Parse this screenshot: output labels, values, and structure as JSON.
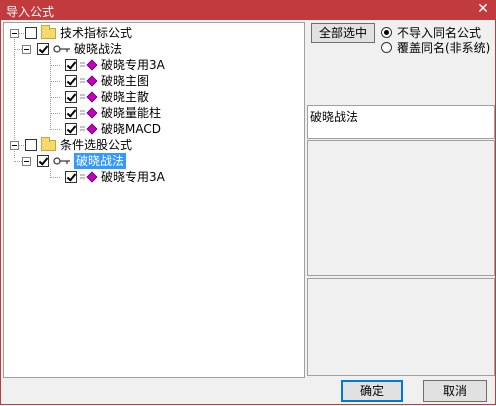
{
  "window": {
    "title": "导入公式",
    "close_glyph": "✕"
  },
  "tree": {
    "groups": [
      {
        "label": "技术指标公式",
        "checked": false,
        "items": [
          {
            "label": "破晓战法",
            "checked": true,
            "formulas": [
              {
                "label": "破晓专用3A",
                "checked": true
              },
              {
                "label": "破晓主图",
                "checked": true
              },
              {
                "label": "破晓主散",
                "checked": true
              },
              {
                "label": "破晓量能柱",
                "checked": true
              },
              {
                "label": "破晓MACD",
                "checked": true
              }
            ]
          }
        ]
      },
      {
        "label": "条件选股公式",
        "checked": false,
        "items": [
          {
            "label": "破晓战法",
            "checked": true,
            "selected": true,
            "formulas": [
              {
                "label": "破晓专用3A",
                "checked": true
              }
            ]
          }
        ]
      }
    ]
  },
  "right_panel": {
    "select_all_label": "全部选中",
    "options": [
      {
        "label": "不导入同名公式",
        "selected": true
      },
      {
        "label": "覆盖同名(非系统)",
        "selected": false
      }
    ],
    "name_value": "破晓战法"
  },
  "footer": {
    "ok_label": "确定",
    "cancel_label": "取消"
  },
  "colors": {
    "title_bar": "#c13a3e",
    "selection": "#3399ff"
  }
}
